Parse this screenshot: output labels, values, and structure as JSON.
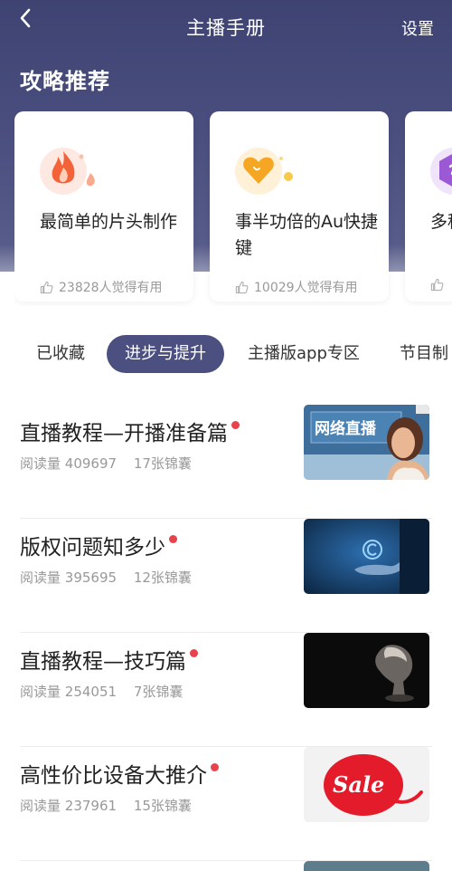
{
  "header": {
    "title": "主播手册",
    "settings_label": "设置",
    "back_icon": "chevron-left-icon"
  },
  "recommend": {
    "title": "攻略推荐",
    "cards": [
      {
        "title": "最简单的片头制作",
        "likes": "23828人觉得有用",
        "icon": "flame-icon",
        "accent": "#f4623a"
      },
      {
        "title": "事半功倍的Au快捷键",
        "likes": "10029人觉得有用",
        "icon": "heart-icon",
        "accent": "#f5a623"
      },
      {
        "title": "多种来下",
        "likes": "",
        "icon": "hexagon-icon",
        "accent": "#9b59d6"
      }
    ]
  },
  "tabs": [
    {
      "label": "已收藏",
      "active": false
    },
    {
      "label": "进步与提升",
      "active": true
    },
    {
      "label": "主播版app专区",
      "active": false
    },
    {
      "label": "节目制",
      "active": false
    }
  ],
  "articles": [
    {
      "title": "直播教程—开播准备篇",
      "views_label": "阅读量",
      "views": "409697",
      "cards": "17张锦囊",
      "thumb": "网络直播"
    },
    {
      "title": "版权问题知多少",
      "views_label": "阅读量",
      "views": "395695",
      "cards": "12张锦囊",
      "thumb": "copyright-hand"
    },
    {
      "title": "直播教程—技巧篇",
      "views_label": "阅读量",
      "views": "254051",
      "cards": "7张锦囊",
      "thumb": "chess-knight"
    },
    {
      "title": "高性价比设备大推介",
      "views_label": "阅读量",
      "views": "237961",
      "cards": "15张锦囊",
      "thumb": "Sale"
    }
  ],
  "colors": {
    "header": "#4b5080",
    "active_tab": "#4b5080",
    "new_dot": "#e8424d"
  }
}
